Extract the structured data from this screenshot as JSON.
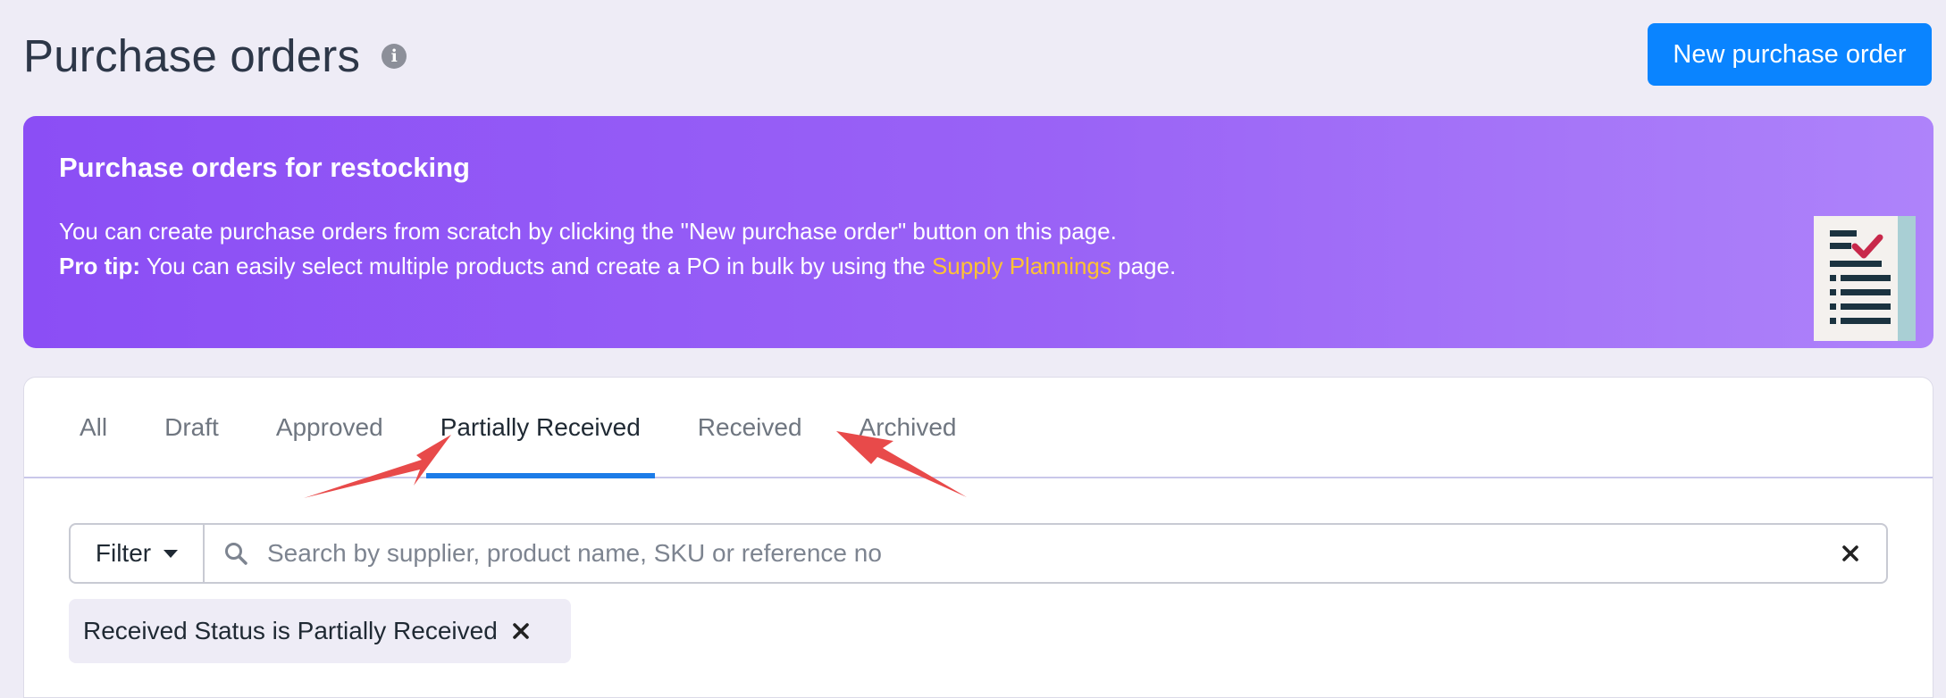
{
  "page": {
    "title": "Purchase orders",
    "new_button_label": "New purchase order"
  },
  "banner": {
    "title": "Purchase orders for restocking",
    "line1": "You can create purchase orders from scratch by clicking the \"New purchase order\" button on this page.",
    "line2_bold": "Pro tip:",
    "line2_before_link": " You can easily select multiple products and create a PO in bulk by using the ",
    "link_text": "Supply Plannings",
    "line2_after_link": " page.",
    "link_color": "#ffc233"
  },
  "tabs": [
    {
      "label": "All",
      "active": false
    },
    {
      "label": "Draft",
      "active": false
    },
    {
      "label": "Approved",
      "active": false
    },
    {
      "label": "Partially Received",
      "active": true
    },
    {
      "label": "Received",
      "active": false
    },
    {
      "label": "Archived",
      "active": false
    }
  ],
  "filter": {
    "button_label": "Filter",
    "search_placeholder": "Search by supplier, product name, SKU or reference no",
    "search_value": ""
  },
  "active_filter_chip": "Received Status is Partially Received",
  "colors": {
    "primary": "#0a84ff",
    "active_tab_underline": "#1c7ce8",
    "annotation_arrow": "#e84a4a",
    "banner_start": "#8b4ef5",
    "banner_end": "#ae83fa"
  },
  "icons": {
    "info": "info-icon",
    "search": "search-icon",
    "clear": "close-icon",
    "chip_remove": "close-icon",
    "illustration": "checklist-document-icon"
  }
}
